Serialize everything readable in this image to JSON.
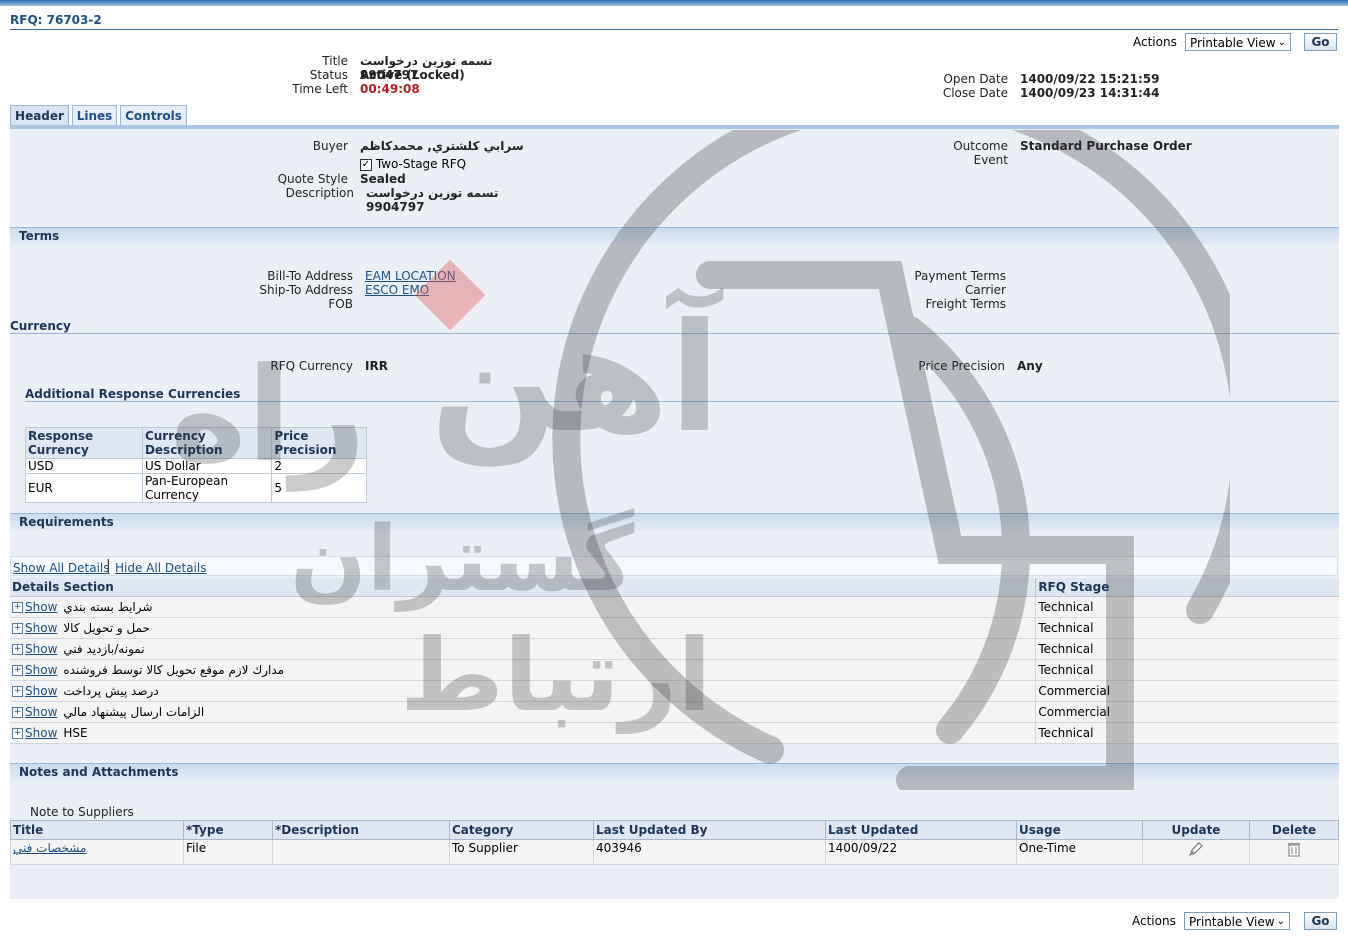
{
  "page": {
    "rfq_title": "RFQ: 76703-2"
  },
  "actions": {
    "label": "Actions",
    "selected": "Printable View",
    "go_label": "Go"
  },
  "summary": {
    "title_label": "Title",
    "title_value": "تسمه توزین درخواست 9904797",
    "status_label": "Status",
    "status_value": "Active (Locked)",
    "time_left_label": "Time Left",
    "time_left_value": "00:49:08",
    "open_date_label": "Open Date",
    "open_date_value": "1400/09/22 15:21:59",
    "close_date_label": "Close Date",
    "close_date_value": "1400/09/23 14:31:44"
  },
  "tabs": [
    {
      "label": "Header",
      "active": true
    },
    {
      "label": "Lines",
      "active": false
    },
    {
      "label": "Controls",
      "active": false
    }
  ],
  "header": {
    "buyer_label": "Buyer",
    "buyer_value": "سرابي كلشتري, محمدكاظم",
    "two_stage_label": "Two-Stage RFQ",
    "two_stage_checked": true,
    "quote_style_label": "Quote Style",
    "quote_style_value": "Sealed",
    "description_label": "Description",
    "description_value": "تسمه توزین درخواست 9904797",
    "outcome_label": "Outcome",
    "outcome_value": "Standard Purchase Order",
    "event_label": "Event"
  },
  "terms": {
    "section_title": "Terms",
    "bill_to_label": "Bill-To Address",
    "bill_to_value": "EAM LOCATION",
    "ship_to_label": "Ship-To Address",
    "ship_to_value": "ESCO EMO",
    "fob_label": "FOB",
    "payment_terms_label": "Payment Terms",
    "carrier_label": "Carrier",
    "freight_terms_label": "Freight Terms"
  },
  "currency": {
    "section_title": "Currency",
    "rfq_currency_label": "RFQ Currency",
    "rfq_currency_value": "IRR",
    "price_precision_label": "Price Precision",
    "price_precision_value": "Any",
    "additional_title": "Additional Response Currencies",
    "columns": [
      "Response Currency",
      "Currency Description",
      "Price Precision"
    ],
    "rows": [
      [
        "USD",
        "US Dollar",
        "2"
      ],
      [
        "EUR",
        "Pan-European Currency",
        "5"
      ]
    ]
  },
  "requirements": {
    "section_title": "Requirements",
    "show_all": "Show All Details",
    "hide_all": "Hide All Details",
    "columns": [
      "Details",
      "Section",
      "RFQ Stage"
    ],
    "show_label": "Show",
    "rows": [
      {
        "section": "شرايط بسته بندي",
        "stage": "Technical"
      },
      {
        "section": "حمل و تحويل كالا",
        "stage": "Technical"
      },
      {
        "section": "نمونه/بازديد فني",
        "stage": "Technical"
      },
      {
        "section": "مدارك لازم موقع تحويل كالا توسط فروشنده",
        "stage": "Technical"
      },
      {
        "section": "درصد پيش پرداخت",
        "stage": "Commercial"
      },
      {
        "section": "الزامات ارسال پيشنهاد مالي",
        "stage": "Commercial"
      },
      {
        "section": "HSE",
        "stage": "Technical"
      }
    ]
  },
  "notes": {
    "section_title": "Notes and Attachments",
    "note_label": "Note to Suppliers",
    "columns": [
      "Title",
      "*Type",
      "*Description",
      "Category",
      "Last Updated By",
      "Last Updated",
      "Usage",
      "Update",
      "Delete"
    ],
    "rows": [
      {
        "title": "مشخصات فني",
        "type": "File",
        "description": "",
        "category": "To Supplier",
        "updated_by": "403946",
        "updated": "1400/09/22",
        "usage": "One-Time"
      }
    ]
  },
  "colors": {
    "accent": "#1d4f86",
    "time_left": "#b02020",
    "panel": "#eaf0f6"
  }
}
